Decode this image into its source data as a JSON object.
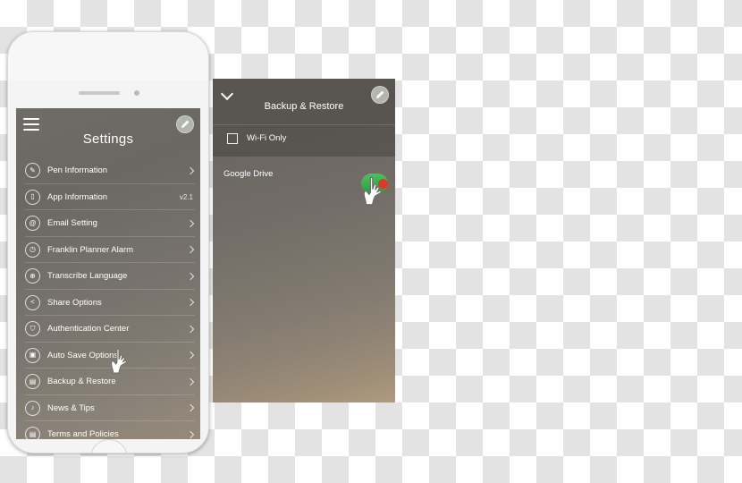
{
  "meta": {
    "scene": "smartphone-mockup-with-app-settings-screens",
    "accent_green": "#3aa84c",
    "accent_red": "#d93b2b",
    "text_color": "#ffffff"
  },
  "phone": {
    "device_name": "white-smartphone",
    "screen": {
      "header": {
        "menu_icon": "hamburger-menu-icon",
        "title": "Settings",
        "badge_icon": "pen-icon"
      },
      "items": [
        {
          "icon": "pen-icon",
          "label": "Pen Information",
          "accessory": "chevron"
        },
        {
          "icon": "phone-icon",
          "label": "App Information",
          "accessory": "text",
          "value": "v2.1"
        },
        {
          "icon": "email-icon",
          "label": "Email Setting",
          "accessory": "chevron"
        },
        {
          "icon": "clock-icon",
          "label": "Franklin Planner Alarm",
          "accessory": "chevron"
        },
        {
          "icon": "globe-icon",
          "label": "Transcribe Language",
          "accessory": "chevron"
        },
        {
          "icon": "share-icon",
          "label": "Share Options",
          "accessory": "chevron"
        },
        {
          "icon": "shield-icon",
          "label": "Authentication Center",
          "accessory": "chevron"
        },
        {
          "icon": "save-icon",
          "label": "Auto Save Options",
          "accessory": "chevron"
        },
        {
          "icon": "backup-icon",
          "label": "Backup & Restore",
          "accessory": "chevron"
        },
        {
          "icon": "bell-icon",
          "label": "News & Tips",
          "accessory": "chevron"
        },
        {
          "icon": "document-icon",
          "label": "Terms and Policies",
          "accessory": "chevron"
        }
      ],
      "cursor": "hand-pointer-cursor"
    }
  },
  "panel": {
    "header": {
      "back_icon": "chevron-down-icon",
      "title": "Backup & Restore",
      "badge_icon": "pen-icon"
    },
    "wifi_option": {
      "checkbox": "unchecked-checkbox",
      "label": "Wi-Fi Only"
    },
    "service_row": {
      "label": "Google Drive",
      "cursor": "hand-pointer-cursor"
    }
  }
}
